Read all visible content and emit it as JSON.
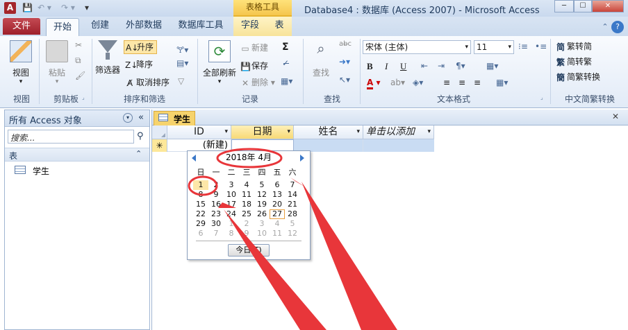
{
  "titlebar": {
    "app_icon": "A",
    "title": "Database4 : 数据库 (Access 2007)  -  Microsoft Access",
    "context_group": "表格工具",
    "win_minimize": "─",
    "win_maximize": "☐",
    "win_close": "✕"
  },
  "tabs": {
    "file": "文件",
    "items": [
      "开始",
      "创建",
      "外部数据",
      "数据库工具",
      "字段",
      "表"
    ],
    "active": "开始",
    "help_min": "⌃",
    "help": "?"
  },
  "ribbon": {
    "groups": {
      "view": "视图",
      "clipboard": "剪贴板",
      "sortfilter": "排序和筛选",
      "records": "记录",
      "find": "查找",
      "textfmt": "文本格式",
      "chinese": "中文简繁转换"
    },
    "view_btn": "视图",
    "paste_btn": "粘贴",
    "filter_btn": "筛选器",
    "asc": "升序",
    "desc": "降序",
    "remove_sort": "取消排序",
    "refresh_all": "全部刷新",
    "new": "新建",
    "save": "保存",
    "delete": "删除",
    "find_btn": "查找",
    "font_name": "宋体 (主体)",
    "font_size": "11",
    "bold": "B",
    "italic": "I",
    "underline": "U",
    "font_color_a": "A",
    "to_simplified": "繁转简",
    "to_traditional": "简转繁",
    "convert": "简繁转换"
  },
  "nav": {
    "header": "所有 Access 对象",
    "search_placeholder": "搜索...",
    "section": "表",
    "item": "学生"
  },
  "doc": {
    "tab": "学生",
    "close": "✕",
    "columns": [
      "ID",
      "日期",
      "姓名",
      "单击以添加"
    ],
    "new_row_marker": "✳",
    "new_row_id": "(新建)"
  },
  "calendar": {
    "month_label": "2018年  4月",
    "weekdays": [
      "日",
      "一",
      "二",
      "三",
      "四",
      "五",
      "六"
    ],
    "weeks": [
      [
        "1",
        "2",
        "3",
        "4",
        "5",
        "6",
        "7"
      ],
      [
        "8",
        "9",
        "10",
        "11",
        "12",
        "13",
        "14"
      ],
      [
        "15",
        "16",
        "17",
        "18",
        "19",
        "20",
        "21"
      ],
      [
        "22",
        "23",
        "24",
        "25",
        "26",
        "27",
        "28"
      ],
      [
        "29",
        "30",
        "1",
        "2",
        "3",
        "4",
        "5"
      ],
      [
        "6",
        "7",
        "8",
        "9",
        "10",
        "11",
        "12"
      ]
    ],
    "selected": "1",
    "today": "27",
    "today_button": "今日(T)"
  },
  "colors": {
    "accent": "#1e395b",
    "file_tab": "#b02b36",
    "annotation": "#e8363a",
    "selected_bg": "#fde7a8",
    "today_border": "#e8a040",
    "active_col": "#fde89a"
  }
}
